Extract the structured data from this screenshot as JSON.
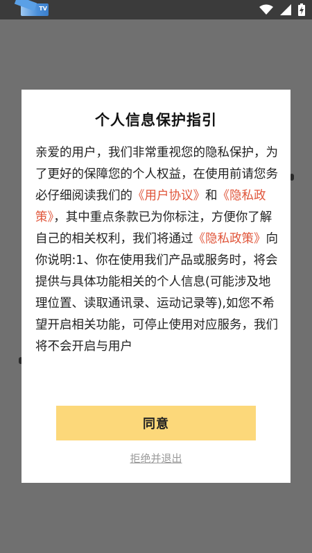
{
  "status_bar": {
    "app_badge": "TV",
    "icons": [
      "wifi-icon",
      "signal-icon",
      "battery-icon"
    ]
  },
  "dialog": {
    "title": "个人信息保护指引",
    "body_parts": [
      {
        "text": "亲爱的用户，我们非常重视您的隐私保护，为了更好的保障您的个人权益，在使用前请您务必仔细阅读我们的",
        "link": false
      },
      {
        "text": "《用户协议》",
        "link": true
      },
      {
        "text": "和",
        "link": false
      },
      {
        "text": "《隐私政策》",
        "link": true
      },
      {
        "text": "，其中重点条款已为你标注，方便你了解自己的相关权利，我们将通过",
        "link": false
      },
      {
        "text": "《隐私政策》",
        "link": true
      },
      {
        "text": "向你说明:1、你在使用我们产品或服务时，将会提供与具体功能相关的个人信息(可能涉及地理位置、读取通讯录、运动记录等),如您不希望开启相关功能，可停止使用对应服务，我们将不会开启与用户",
        "link": false
      }
    ],
    "agree_label": "同意",
    "reject_label": "拒绝并退出"
  },
  "colors": {
    "overlay": "#707070",
    "link": "#e0563b",
    "agree_button": "#fcd87a",
    "reject_text": "#9a9a9a"
  }
}
